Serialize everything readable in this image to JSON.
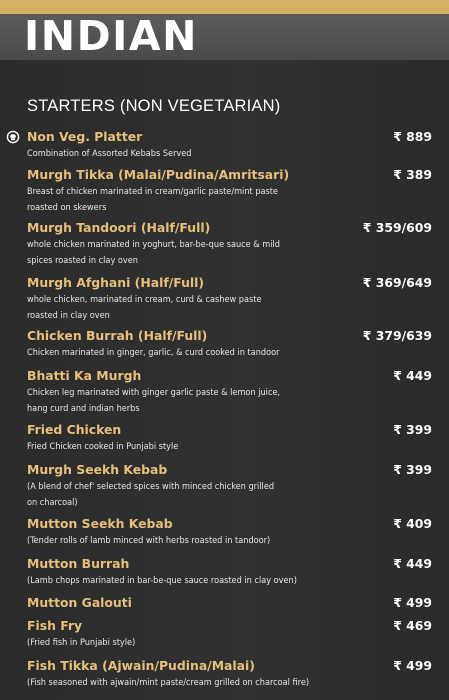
{
  "page": {
    "title": "INDIAN",
    "section": "STARTERS (NON VEGETARIAN)"
  },
  "items": [
    {
      "name": "Non Veg. Platter",
      "price": "₹ 889",
      "desc": [
        "Combination of Assorted Kebabs Served"
      ]
    },
    {
      "name": "Murgh Tikka (Malai/Pudina/Amritsari)",
      "price": "₹ 389",
      "desc": [
        "Breast of chicken marinated in cream/garlic paste/mint paste",
        "roasted on skewers"
      ]
    },
    {
      "name": "Murgh Tandoori (Half/Full)",
      "price": "₹ 359/609",
      "desc": [
        "whole chicken marinated in yoghurt, bar-be-que sauce & mild",
        "spices roasted in clay oven"
      ]
    },
    {
      "name": "Murgh Afghani (Half/Full)",
      "price": "₹ 369/649",
      "desc": [
        "whole chicken, marinated in cream, curd & cashew paste",
        "roasted in clay oven"
      ]
    },
    {
      "name": "Chicken Burrah (Half/Full)",
      "price": "₹ 379/639",
      "desc": [
        "Chicken marinated in ginger, garlic, & curd cooked in tandoor"
      ]
    },
    {
      "name": "Bhatti Ka Murgh",
      "price": "₹ 449",
      "desc": [
        "Chicken leg marinated with ginger garlic paste & lemon juice,",
        "hang curd and indian herbs"
      ]
    },
    {
      "name": "Fried Chicken",
      "price": "₹ 399",
      "desc": [
        "Fried Chicken cooked in Punjabi style"
      ]
    },
    {
      "name": "Murgh Seekh Kebab",
      "price": "₹ 399",
      "desc": [
        "(A blend of chef' selected spices with minced chicken grilled",
        "on charcoal)"
      ]
    },
    {
      "name": "Mutton Seekh Kebab",
      "price": "₹ 409",
      "desc": [
        "(Tender rolls of lamb minced with herbs roasted in tandoor)"
      ]
    },
    {
      "name": "Mutton Burrah",
      "price": "₹ 449",
      "desc": [
        "(Lamb chops marinated in bar-be-que sauce roasted in clay oven)"
      ]
    },
    {
      "name": "Mutton Galouti",
      "price": "₹ 499",
      "desc": []
    },
    {
      "name": "Fish Fry",
      "price": "₹ 469",
      "desc": [
        "(Fried fish in Punjabi style)"
      ]
    },
    {
      "name": "Fish Tikka (Ajwain/Pudina/Malai)",
      "price": "₹ 499",
      "desc": [
        "(Fish seasoned with ajwain/mint paste/cream grilled on charcoal fire)"
      ]
    }
  ],
  "colors": {
    "item_name": "#e6c07a",
    "accent_strip": "#d4b064",
    "background": "#2a2a2b"
  },
  "icons": {
    "signature_marker": "chef-hat-icon"
  }
}
